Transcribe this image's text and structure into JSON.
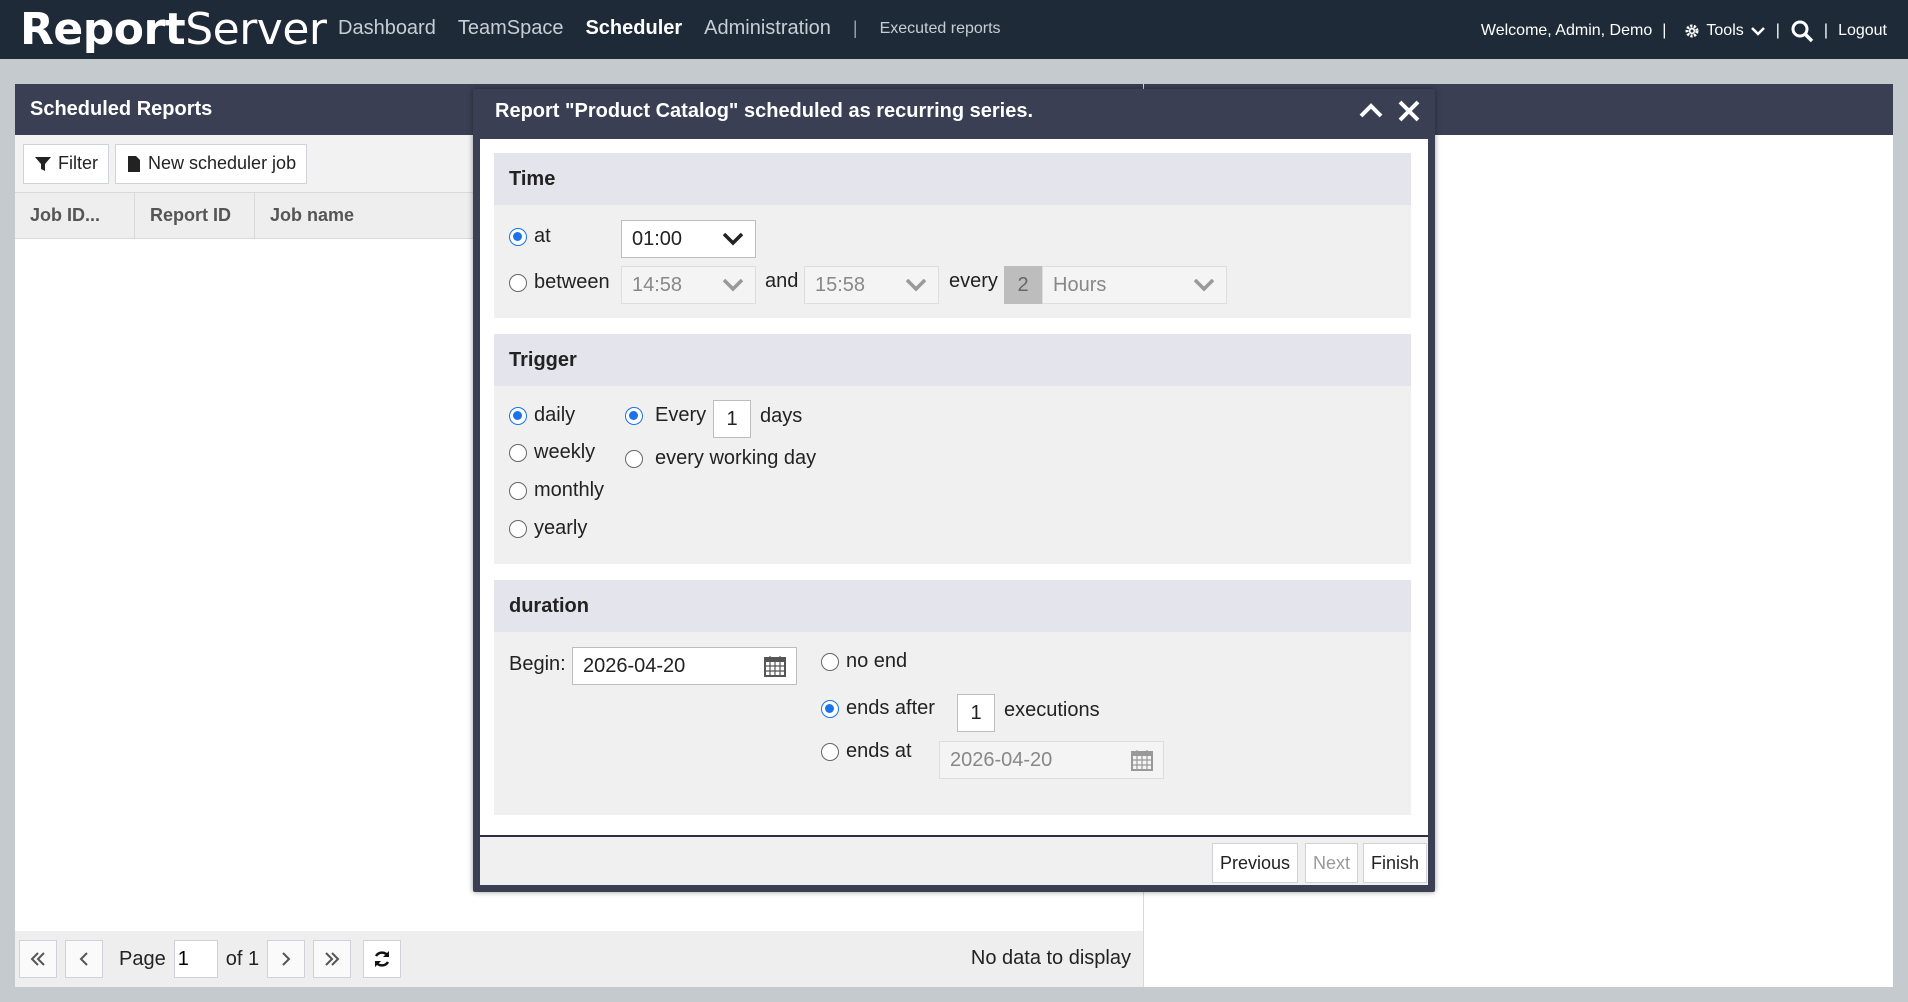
{
  "app": {
    "logo_bold": "Report",
    "logo_rest": "Server"
  },
  "nav": {
    "items": [
      "Dashboard",
      "TeamSpace",
      "Scheduler",
      "Administration"
    ],
    "separator": "|",
    "executed": "Executed reports"
  },
  "user": {
    "welcome": "Welcome, Admin, Demo",
    "tools": "Tools",
    "logout": "Logout",
    "bar": "|"
  },
  "panel": {
    "title": "Scheduled Reports",
    "filter": "Filter",
    "new_job": "New scheduler job",
    "columns": [
      "Job ID...",
      "Report ID",
      "Job name"
    ],
    "pager": {
      "page_label": "Page",
      "page_value": "1",
      "of_label": "of 1",
      "no_data": "No data to display"
    }
  },
  "modal": {
    "title": "Report \"Product Catalog\" scheduled as recurring series.",
    "time": {
      "heading": "Time",
      "at_label": "at",
      "at_value": "01:00",
      "between_label": "between",
      "between_from": "14:58",
      "and_label": "and",
      "between_to": "15:58",
      "every_label": "every",
      "every_value": "2",
      "unit": "Hours"
    },
    "trigger": {
      "heading": "Trigger",
      "options": [
        "daily",
        "weekly",
        "monthly",
        "yearly"
      ],
      "every_label": "Every",
      "every_value": "1",
      "days_label": "days",
      "working_day": "every working day"
    },
    "duration": {
      "heading": "duration",
      "begin_label": "Begin:",
      "begin_value": "2026-04-20",
      "no_end": "no end",
      "ends_after": "ends after",
      "ends_after_value": "1",
      "executions": "executions",
      "ends_at": "ends at",
      "ends_at_value": "2026-04-20"
    },
    "footer": {
      "previous": "Previous",
      "next": "Next",
      "finish": "Finish"
    }
  },
  "colors": {
    "topbar": "#1f2a38",
    "header": "#3a3f54",
    "radio_on": "#1a73e8"
  },
  "icons": [
    "filter-icon",
    "document-icon",
    "gear-icon",
    "chevron-down-icon",
    "search-icon",
    "collapse-icon",
    "close-icon",
    "calendar-icon",
    "first-page-icon",
    "prev-page-icon",
    "next-page-icon",
    "last-page-icon",
    "refresh-icon"
  ]
}
